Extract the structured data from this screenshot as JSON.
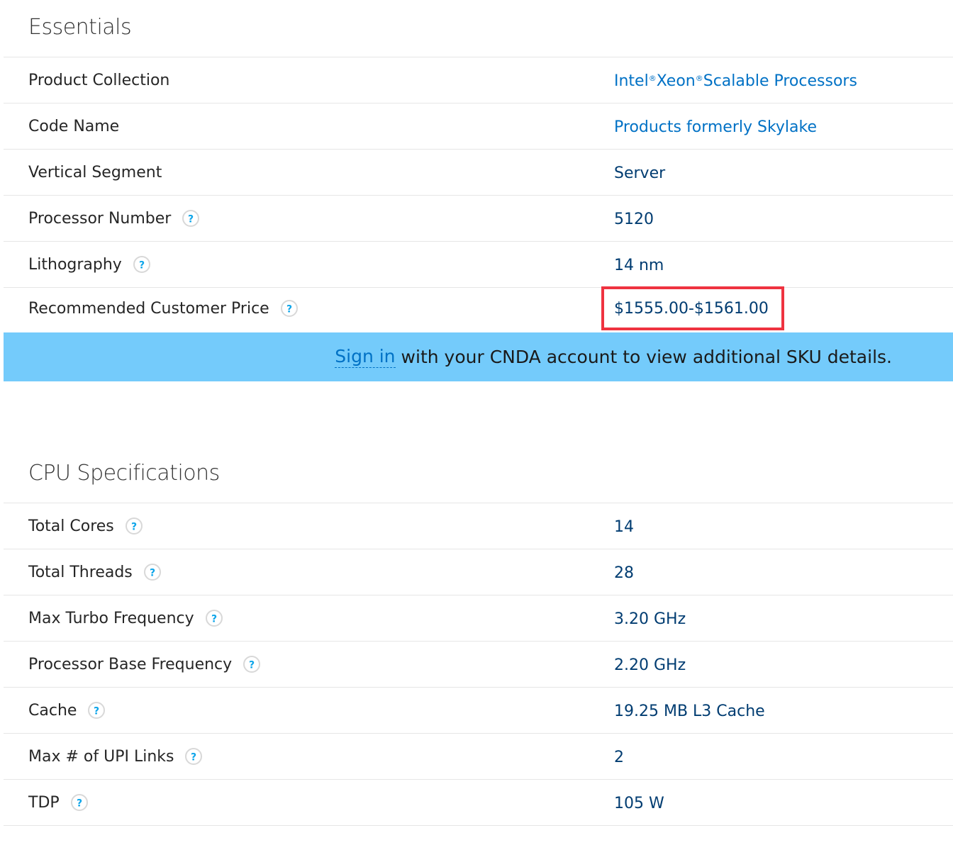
{
  "essentials": {
    "title": "Essentials",
    "rows": [
      {
        "label": "Product Collection",
        "value_main": "Intel",
        "value_reg1": "®",
        "value_mid": " Xeon",
        "value_reg2": "®",
        "value_tail": " Scalable Processors"
      },
      {
        "label": "Code Name",
        "value": "Products formerly Skylake"
      },
      {
        "label": "Vertical Segment",
        "value": "Server"
      },
      {
        "label": "Processor Number",
        "value": "5120"
      },
      {
        "label": "Lithography",
        "value": "14 nm"
      },
      {
        "label": "Recommended Customer Price",
        "value": "$1555.00-$1561.00"
      }
    ]
  },
  "banner": {
    "link": "Sign in",
    "text": "with your CNDA account to view additional SKU details."
  },
  "cpu": {
    "title": "CPU Specifications",
    "rows": [
      {
        "label": "Total Cores",
        "value": "14"
      },
      {
        "label": "Total Threads",
        "value": "28"
      },
      {
        "label": "Max Turbo Frequency",
        "value": "3.20 GHz"
      },
      {
        "label": "Processor Base Frequency",
        "value": "2.20 GHz"
      },
      {
        "label": "Cache",
        "value": "19.25 MB L3 Cache"
      },
      {
        "label": "Max # of UPI Links",
        "value": "2"
      },
      {
        "label": "TDP",
        "value": "105 W"
      }
    ]
  },
  "colors": {
    "value_text": "#003c71",
    "link_text": "#0071c5",
    "banner_bg": "#74cbfb",
    "highlight": "#ef3340",
    "help_icon": "#0ea5e9"
  },
  "icons": {
    "help": "question-mark-icon"
  }
}
